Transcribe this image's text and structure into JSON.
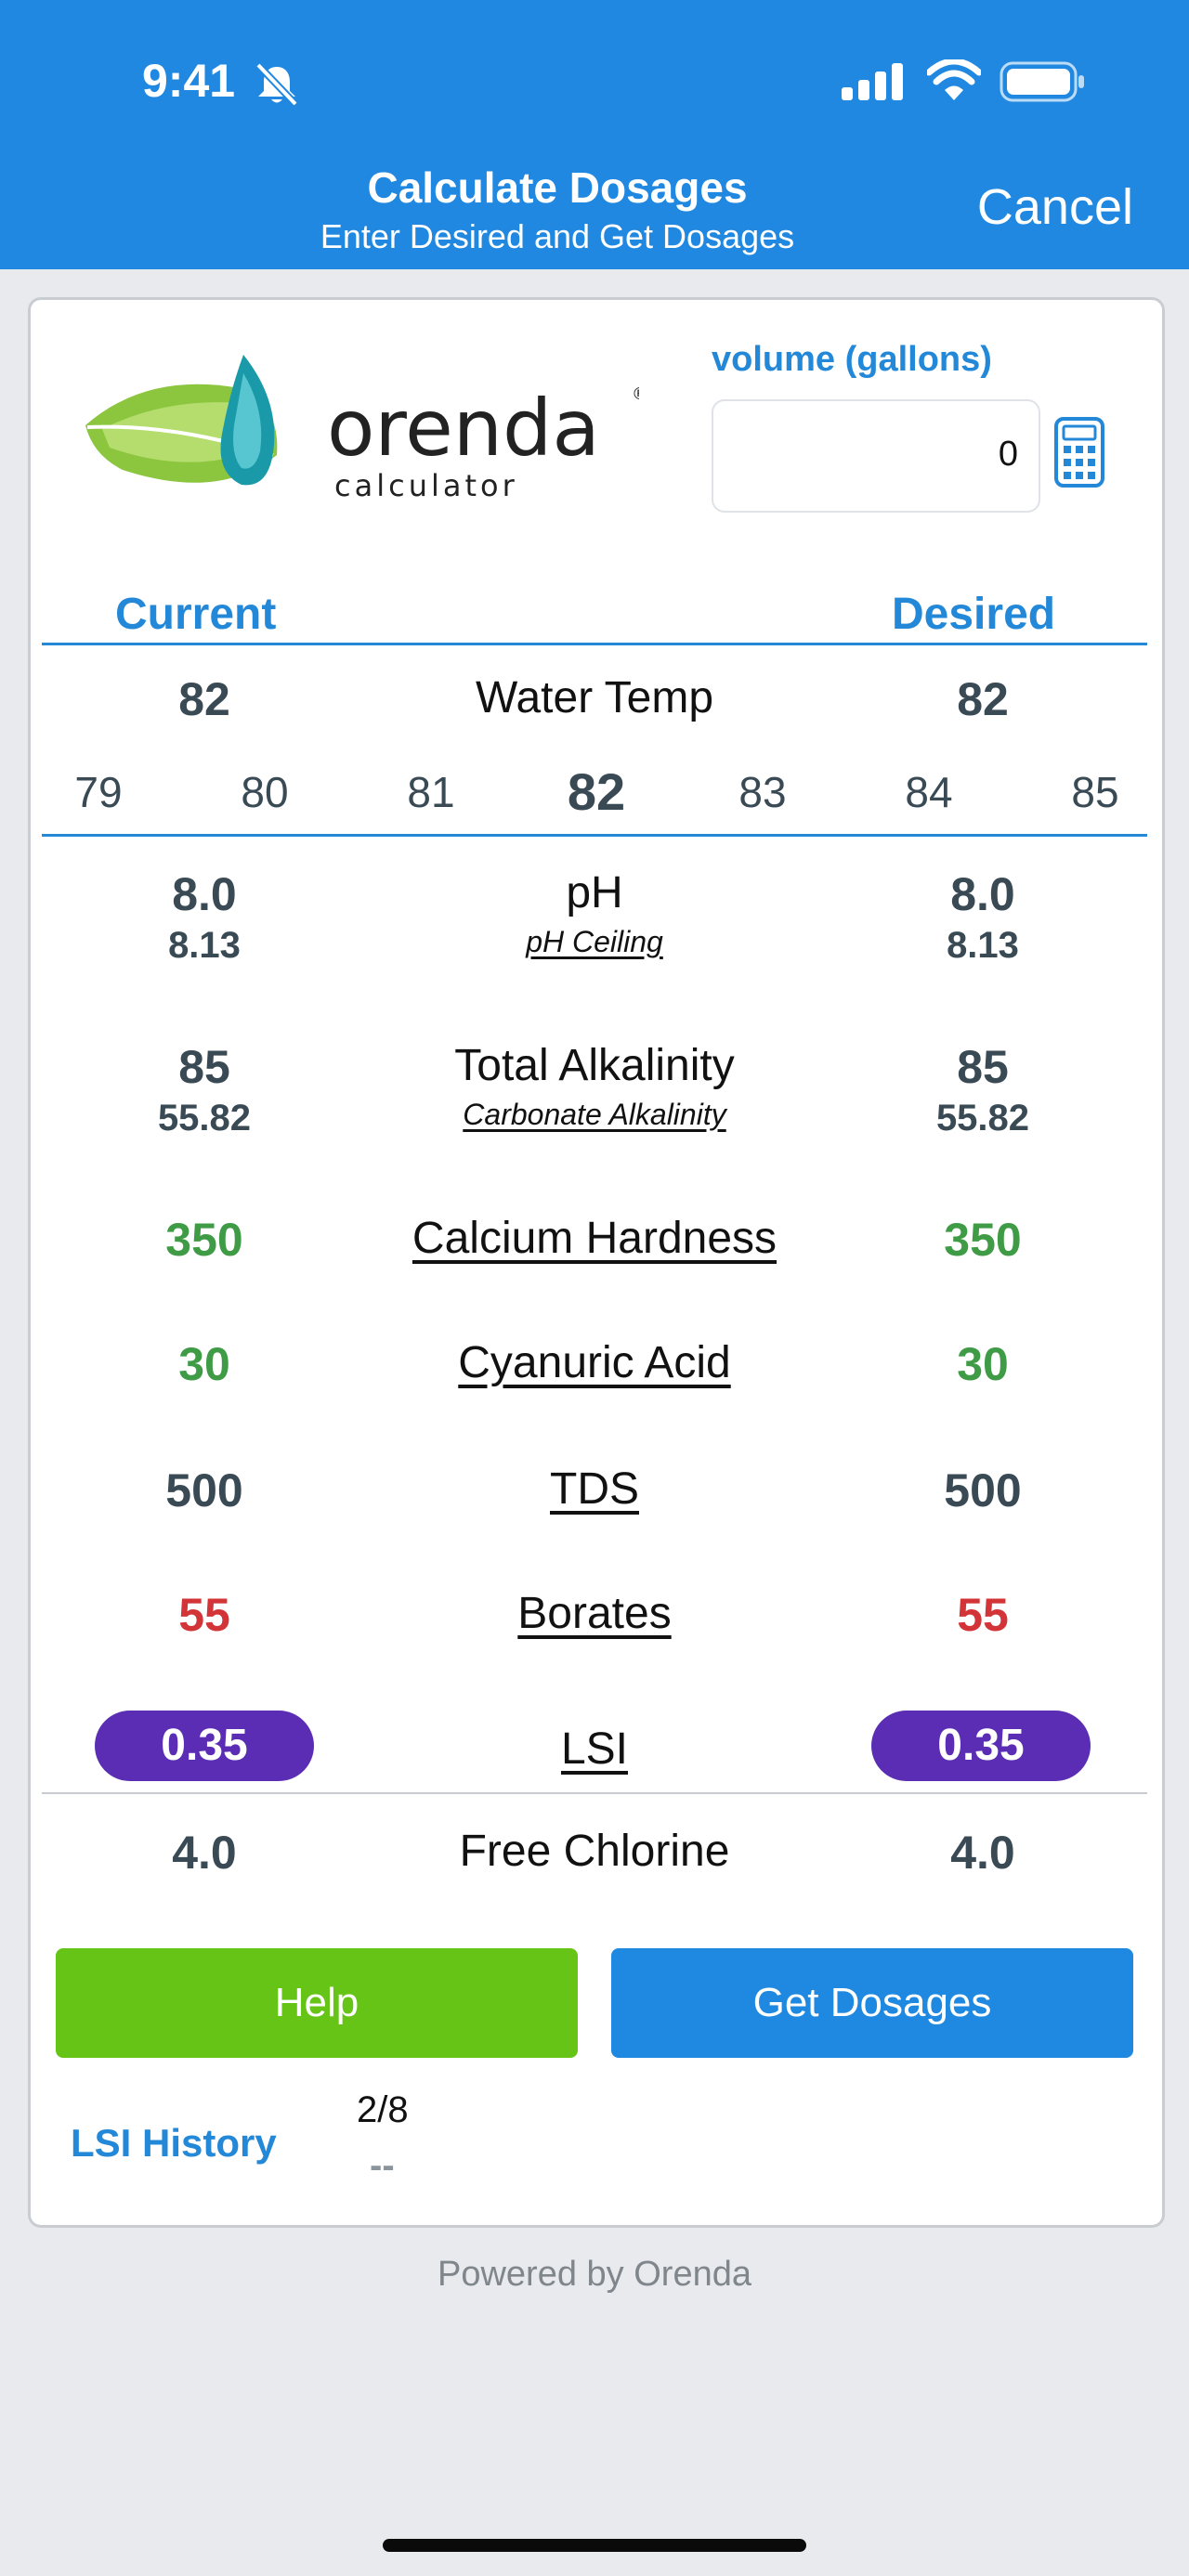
{
  "status_bar": {
    "time": "9:41"
  },
  "nav": {
    "title": "Calculate Dosages",
    "subtitle": "Enter Desired and Get Dosages",
    "cancel": "Cancel"
  },
  "logo": {
    "word": "orenda",
    "sub": "calculator",
    "mark": "®"
  },
  "volume": {
    "label": "volume (gallons)",
    "value": "0"
  },
  "columns": {
    "current": "Current",
    "desired": "Desired"
  },
  "water_temp": {
    "label": "Water Temp",
    "current": "82",
    "desired": "82",
    "scale": [
      "79",
      "80",
      "81",
      "82",
      "83",
      "84",
      "85"
    ]
  },
  "ph": {
    "label": "pH",
    "sublabel": "pH Ceiling",
    "current": "8.0",
    "current_sub": "8.13",
    "desired": "8.0",
    "desired_sub": "8.13"
  },
  "alkalinity": {
    "label": "Total Alkalinity",
    "sublabel": "Carbonate Alkalinity",
    "current": "85",
    "current_sub": "55.82",
    "desired": "85",
    "desired_sub": "55.82"
  },
  "calcium": {
    "label": "Calcium Hardness",
    "current": "350",
    "desired": "350"
  },
  "cya": {
    "label": "Cyanuric Acid",
    "current": "30",
    "desired": "30"
  },
  "tds": {
    "label": "TDS",
    "current": "500",
    "desired": "500"
  },
  "borates": {
    "label": "Borates",
    "current": "55",
    "desired": "55"
  },
  "lsi": {
    "label": "LSI",
    "current": "0.35",
    "desired": "0.35"
  },
  "chlorine": {
    "label": "Free Chlorine",
    "current": "4.0",
    "desired": "4.0"
  },
  "buttons": {
    "help": "Help",
    "get_dosages": "Get Dosages"
  },
  "history": {
    "label": "LSI History",
    "date": "2/8",
    "value": "--"
  },
  "footer": "Powered by Orenda",
  "colors": {
    "header": "#2088e0",
    "accent": "#2488d8",
    "help": "#66c416",
    "pill": "#5a2db4",
    "green": "#3f9b45",
    "red": "#d23437"
  }
}
